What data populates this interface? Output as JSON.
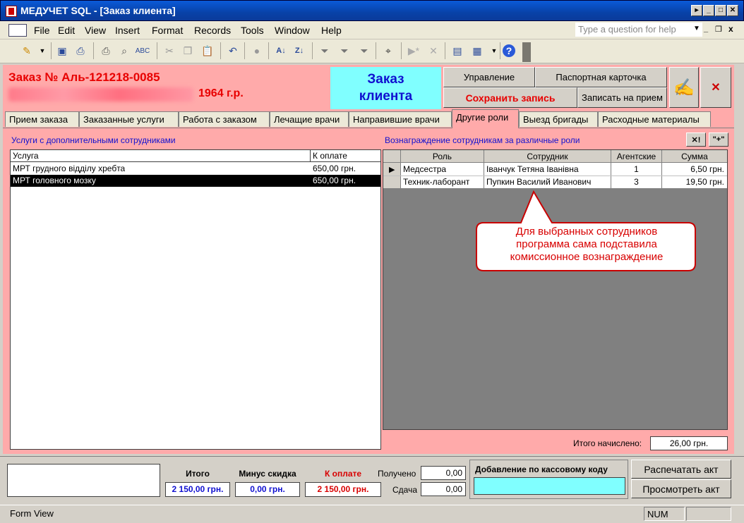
{
  "window": {
    "title": "МЕДУЧЕТ SQL - [Заказ клиента]",
    "controls": [
      "▸",
      "_",
      "□",
      "✕"
    ]
  },
  "menu": {
    "items": [
      "File",
      "Edit",
      "View",
      "Insert",
      "Format",
      "Records",
      "Tools",
      "Window",
      "Help"
    ],
    "ask_placeholder": "Type a question for help"
  },
  "order": {
    "number": "Заказ №  Аль-121218-0085",
    "birth": "1964 г.р."
  },
  "header": {
    "form_title_1": "Заказ",
    "form_title_2": "клиента",
    "btn_manage": "Управление",
    "btn_passport": "Паспортная карточка",
    "btn_save": "Сохранить запись",
    "btn_appointment": "Записать на прием"
  },
  "tabs": [
    "Прием заказа",
    "Заказанные услуги",
    "Работа с заказом",
    "Лечащие врачи",
    "Направившие врачи",
    "Другие роли",
    "Выезд бригады",
    "Расходные материалы"
  ],
  "left_panel": {
    "title": "Услуги с дополнительными сотрудниками",
    "columns": [
      "Услуга",
      "К оплате"
    ],
    "rows": [
      {
        "service": "МРТ грудного відділу хребта",
        "amount": "650,00 грн."
      },
      {
        "service": "МРТ головного мозку",
        "amount": "650,00 грн."
      }
    ]
  },
  "right_panel": {
    "title": "Вознаграждение сотрудникам за различные роли",
    "btn_delete": "✕!",
    "btn_add": "\"+\"",
    "columns": [
      "Роль",
      "Сотрудник",
      "Агентские",
      "Сумма"
    ],
    "rows": [
      {
        "role": "Медсестра",
        "employee": "Іванчук Тетяна Іванівна",
        "agent": "1",
        "sum": "6,50 грн."
      },
      {
        "role": "Техник-лаборант",
        "employee": "Пупкин Василий Иванович",
        "agent": "3",
        "sum": "19,50 грн."
      }
    ],
    "total_label": "Итого начислено:",
    "total_value": "26,00 грн."
  },
  "callout": {
    "line1": "Для выбранных сотрудников",
    "line2": "программа сама подставила",
    "line3": "комиссионное вознаграждение"
  },
  "footer": {
    "total_label": "Итого",
    "total_value": "2 150,00 грн.",
    "discount_label": "Минус скидка",
    "discount_value": "0,00 грн.",
    "pay_label": "К оплате",
    "pay_value": "2 150,00 грн.",
    "received_label": "Получено",
    "received_value": "0,00",
    "change_label": "Сдача",
    "change_value": "0,00",
    "cash_code_label": "Добавление по кассовому коду",
    "btn_print": "Распечатать акт",
    "btn_view": "Просмотреть акт"
  },
  "status": {
    "view": "Form View",
    "num": "NUM"
  },
  "colors": {
    "form_bg": "#ffaaaa",
    "title_bg": "#80ffff",
    "accent_red": "#e80000",
    "label_blue": "#1010d0"
  }
}
